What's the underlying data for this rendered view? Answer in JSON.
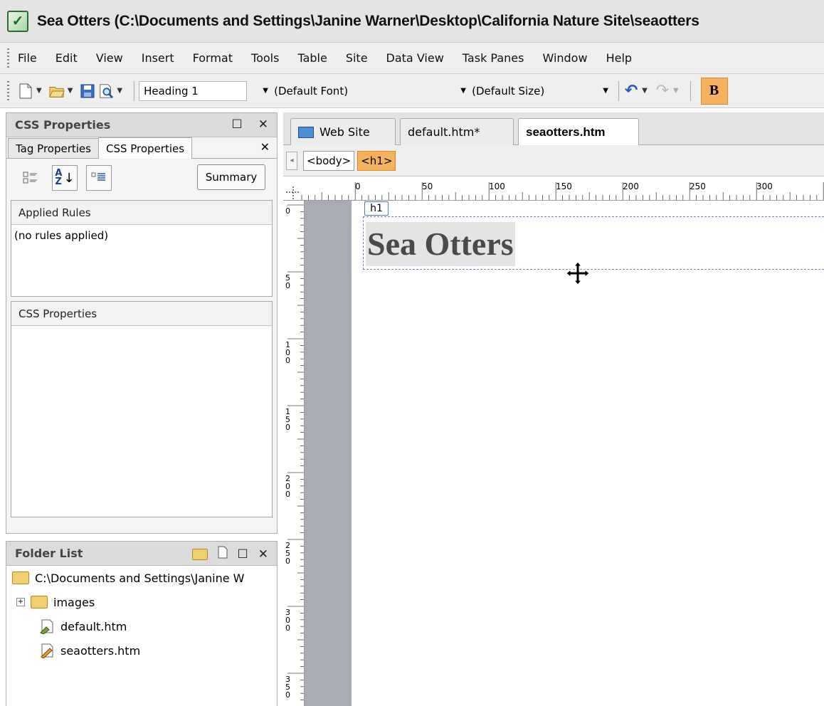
{
  "window": {
    "title": "Sea Otters (C:\\Documents and Settings\\Janine Warner\\Desktop\\California Nature Site\\seaotters"
  },
  "menubar": {
    "items": [
      "File",
      "Edit",
      "View",
      "Insert",
      "Format",
      "Tools",
      "Table",
      "Site",
      "Data View",
      "Task Panes",
      "Window",
      "Help"
    ]
  },
  "toolbar": {
    "style_combo": "Heading 1",
    "font_combo": "(Default Font)",
    "size_combo": "(Default Size)",
    "bold_label": "B"
  },
  "css_panel": {
    "title": "CSS Properties",
    "tabs": [
      "Tag Properties",
      "CSS Properties"
    ],
    "summary_label": "Summary",
    "applied_rules_header": "Applied Rules",
    "applied_rules_empty": "(no rules applied)",
    "css_properties_header": "CSS Properties"
  },
  "folder_list": {
    "title": "Folder List",
    "root": "C:\\Documents and Settings\\Janine W",
    "items": [
      "images",
      "default.htm",
      "seaotters.htm"
    ]
  },
  "document_tabs": [
    "Web Site",
    "default.htm*",
    "seaotters.htm"
  ],
  "breadcrumbs": [
    "<body>",
    "<h1>"
  ],
  "ruler": {
    "h_labels": [
      "0",
      "50",
      "100",
      "150",
      "200",
      "250",
      "300"
    ],
    "v_labels": [
      "0",
      "50",
      "100",
      "150",
      "200",
      "250",
      "300",
      "350"
    ]
  },
  "editor": {
    "tag_label": "h1",
    "heading": "Sea Otters"
  }
}
